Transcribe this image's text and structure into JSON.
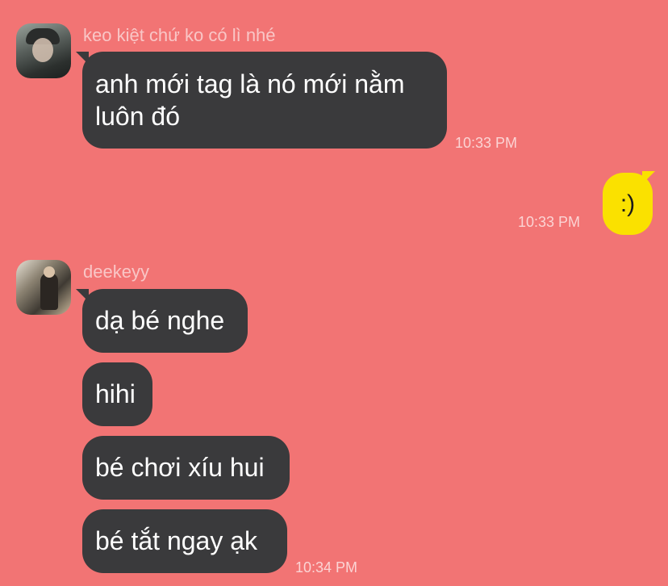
{
  "messages": [
    {
      "sender": "keo kiệt chứ ko có lì nhé",
      "bubbles": [
        "anh mới tag là nó mới nằm luôn đó"
      ],
      "time": "10:33 PM"
    },
    {
      "sender": "me",
      "bubbles": [
        ":)"
      ],
      "time": "10:33 PM"
    },
    {
      "sender": "deekeyy",
      "bubbles": [
        "dạ bé nghe",
        "hihi",
        "bé chơi xíu hui",
        "bé tắt ngay ạk"
      ],
      "time": "10:34 PM"
    }
  ],
  "colors": {
    "background": "#f27474",
    "incoming_bubble": "#3a3a3c",
    "outgoing_bubble": "#fae100"
  }
}
